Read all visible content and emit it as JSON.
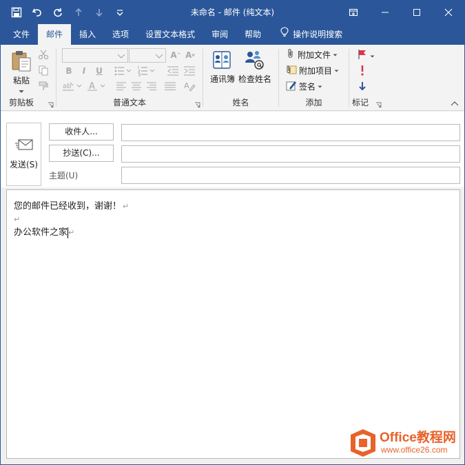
{
  "window": {
    "title": "未命名  -  邮件 (纯文本)"
  },
  "tabs": [
    {
      "label": "文件"
    },
    {
      "label": "邮件"
    },
    {
      "label": "插入"
    },
    {
      "label": "选项"
    },
    {
      "label": "设置文本格式"
    },
    {
      "label": "审阅"
    },
    {
      "label": "帮助"
    },
    {
      "label": "操作说明搜索"
    }
  ],
  "ribbon": {
    "clipboard": {
      "paste": "粘贴",
      "label": "剪贴板"
    },
    "basic_text": {
      "label": "普通文本"
    },
    "names": {
      "address_book": "通讯簿",
      "check_names": "检查姓名",
      "label": "姓名"
    },
    "include": {
      "attach_file": "附加文件",
      "attach_item": "附加项目",
      "signature": "签名",
      "label": "添加"
    },
    "tags": {
      "label": "标记"
    }
  },
  "header": {
    "send": "发送(S)",
    "to": "收件人...",
    "cc": "抄送(C)...",
    "subject_label": "主题(U)",
    "to_value": "",
    "cc_value": "",
    "subject_value": ""
  },
  "body": {
    "lines": [
      "您的邮件已经收到，谢谢！",
      "",
      "办公软件之家"
    ]
  },
  "watermark": {
    "line1": "Office教程网",
    "line2": "www.office26.com"
  },
  "colors": {
    "accent": "#2b579a",
    "watermark": "#e8622a",
    "flag": "#e2314a"
  }
}
